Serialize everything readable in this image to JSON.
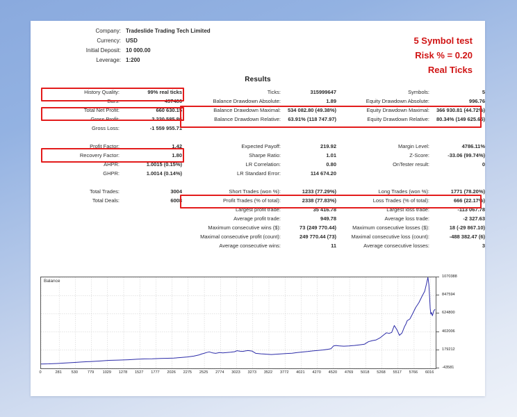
{
  "header": {
    "fields": [
      {
        "label": "Company:",
        "value": "Tradeslide Trading Tech Limited"
      },
      {
        "label": "Currency:",
        "value": "USD"
      },
      {
        "label": "Initial Deposit:",
        "value": "10 000.00"
      },
      {
        "label": "Leverage:",
        "value": "1:200"
      }
    ]
  },
  "annotation": {
    "line1": "5 Symbol test",
    "line2": "Risk % = 0.20",
    "line3": "Real Ticks",
    "color": "#d01414"
  },
  "results_heading": "Results",
  "stats": {
    "group1": [
      {
        "c1": {
          "label": "History Quality:",
          "value": "99% real ticks"
        },
        "c2": {
          "label": "Ticks:",
          "value": "315999647"
        },
        "c3": {
          "label": "Symbols:",
          "value": "5"
        }
      },
      {
        "c1": {
          "label": "Bars:",
          "value": "497486"
        },
        "c2": {
          "label": "Balance Drawdown Absolute:",
          "value": "1.89"
        },
        "c3": {
          "label": "Equity Drawdown Absolute:",
          "value": "996.76"
        }
      },
      {
        "c1": {
          "label": "Total Net Profit:",
          "value": "660 630.15"
        },
        "c2": {
          "label": "Balance Drawdown Maximal:",
          "value": "534 082.80 (49.38%)"
        },
        "c3": {
          "label": "Equity Drawdown Maximal:",
          "value": "366 930.81 (44.72%)"
        }
      },
      {
        "c1": {
          "label": "Gross Profit:",
          "value": "2 220 585.86"
        },
        "c2": {
          "label": "Balance Drawdown Relative:",
          "value": "63.91% (118 747.97)"
        },
        "c3": {
          "label": "Equity Drawdown Relative:",
          "value": "80.34% (149 625.65)"
        }
      },
      {
        "c1": {
          "label": "Gross Loss:",
          "value": "-1 559 955.71"
        },
        "c2": {
          "label": "",
          "value": ""
        },
        "c3": {
          "label": "",
          "value": ""
        }
      }
    ],
    "group2": [
      {
        "c1": {
          "label": "Profit Factor:",
          "value": "1.42"
        },
        "c2": {
          "label": "Expected Payoff:",
          "value": "219.92"
        },
        "c3": {
          "label": "Margin Level:",
          "value": "4786.11%"
        }
      },
      {
        "c1": {
          "label": "Recovery Factor:",
          "value": "1.80"
        },
        "c2": {
          "label": "Sharpe Ratio:",
          "value": "1.01"
        },
        "c3": {
          "label": "Z-Score:",
          "value": "-33.06 (99.74%)"
        }
      },
      {
        "c1": {
          "label": "AHPR:",
          "value": "1.0015 (0.15%)"
        },
        "c2": {
          "label": "LR Correlation:",
          "value": "0.80"
        },
        "c3": {
          "label": "OnTester result:",
          "value": "0"
        }
      },
      {
        "c1": {
          "label": "GHPR:",
          "value": "1.0014 (0.14%)"
        },
        "c2": {
          "label": "LR Standard Error:",
          "value": "114 674.20"
        },
        "c3": {
          "label": "",
          "value": ""
        }
      }
    ],
    "group3": [
      {
        "c1": {
          "label": "Total Trades:",
          "value": "3004"
        },
        "c2": {
          "label": "Short Trades (won %):",
          "value": "1233 (77.29%)"
        },
        "c3": {
          "label": "Long Trades (won %):",
          "value": "1771 (78.20%)"
        }
      },
      {
        "c1": {
          "label": "Total Deals:",
          "value": "6008"
        },
        "c2": {
          "label": "Profit Trades (% of total):",
          "value": "2338 (77.83%)"
        },
        "c3": {
          "label": "Loss Trades (% of total):",
          "value": "666 (22.17%)"
        }
      },
      {
        "c1": {
          "label": "",
          "value": ""
        },
        "c2": {
          "label": "Largest profit trade:",
          "value": "35 416.78"
        },
        "c3": {
          "label": "Largest loss trade:",
          "value": "-113 067.78"
        }
      },
      {
        "c1": {
          "label": "",
          "value": ""
        },
        "c2": {
          "label": "Average profit trade:",
          "value": "949.78"
        },
        "c3": {
          "label": "Average loss trade:",
          "value": "-2 327.63"
        }
      },
      {
        "c1": {
          "label": "",
          "value": ""
        },
        "c2": {
          "label": "Maximum consecutive wins ($):",
          "value": "73 (249 770.44)"
        },
        "c3": {
          "label": "Maximum consecutive losses ($):",
          "value": "18 (-29 867.10)"
        }
      },
      {
        "c1": {
          "label": "",
          "value": ""
        },
        "c2": {
          "label": "Maximal consecutive profit (count):",
          "value": "249 770.44 (73)"
        },
        "c3": {
          "label": "Maximal consecutive loss (count):",
          "value": "-488 382.47 (6)"
        }
      },
      {
        "c1": {
          "label": "",
          "value": ""
        },
        "c2": {
          "label": "Average consecutive wins:",
          "value": "11"
        },
        "c3": {
          "label": "Average consecutive losses:",
          "value": "3"
        }
      }
    ]
  },
  "chart_data": {
    "type": "line",
    "title": "Balance",
    "xlabel": "",
    "ylabel": "",
    "grid": true,
    "legend": "none",
    "line_color": "#2b2ba8",
    "xlim": [
      0,
      6100
    ],
    "ylim": [
      -43581,
      1070388
    ],
    "xticks": [
      0,
      281,
      530,
      779,
      1029,
      1278,
      1527,
      1777,
      2026,
      2275,
      2525,
      2774,
      3023,
      3273,
      3522,
      3772,
      4021,
      4270,
      4520,
      4769,
      5018,
      5268,
      5517,
      5766,
      6016
    ],
    "yticks": [
      1070388,
      847594,
      624800,
      402006,
      179212,
      -43581
    ],
    "series": [
      {
        "name": "Balance",
        "x": [
          0,
          120,
          250,
          380,
          500,
          620,
          760,
          900,
          1050,
          1200,
          1350,
          1480,
          1600,
          1720,
          1850,
          1960,
          2050,
          2150,
          2260,
          2360,
          2440,
          2480,
          2520,
          2560,
          2600,
          2650,
          2700,
          2760,
          2810,
          2870,
          2930,
          2990,
          3030,
          3080,
          3120,
          3160,
          3200,
          3260,
          3320,
          3400,
          3480,
          3560,
          3640,
          3720,
          3800,
          3880,
          3960,
          4040,
          4120,
          4200,
          4280,
          4360,
          4440,
          4480,
          4520,
          4560,
          4600,
          4680,
          4760,
          4840,
          4920,
          5000,
          5060,
          5120,
          5180,
          5240,
          5300,
          5340,
          5380,
          5420,
          5460,
          5500,
          5540,
          5580,
          5600,
          5620,
          5640,
          5660,
          5700,
          5740,
          5790,
          5840,
          5890,
          5930,
          5960,
          5980,
          5995,
          6005,
          6015,
          6025,
          6035,
          6050,
          6070,
          6090
        ],
        "y": [
          10000,
          12000,
          16000,
          22000,
          28000,
          34000,
          40000,
          46000,
          54000,
          58000,
          62000,
          68000,
          72000,
          74000,
          78000,
          80000,
          82000,
          88000,
          96000,
          106000,
          120000,
          132000,
          140000,
          150000,
          158000,
          146000,
          140000,
          150000,
          146000,
          150000,
          154000,
          160000,
          172000,
          166000,
          164000,
          170000,
          174000,
          168000,
          140000,
          134000,
          130000,
          126000,
          130000,
          134000,
          138000,
          142000,
          150000,
          156000,
          162000,
          170000,
          176000,
          182000,
          190000,
          196000,
          230000,
          236000,
          232000,
          228000,
          230000,
          236000,
          244000,
          252000,
          282000,
          296000,
          304000,
          330000,
          368000,
          392000,
          384000,
          396000,
          480000,
          430000,
          360000,
          390000,
          430000,
          470000,
          500000,
          540000,
          560000,
          620000,
          700000,
          760000,
          840000,
          900000,
          1000000,
          1070000,
          980000,
          830000,
          690000,
          620000,
          640000,
          600000,
          660000,
          680000
        ]
      }
    ]
  }
}
